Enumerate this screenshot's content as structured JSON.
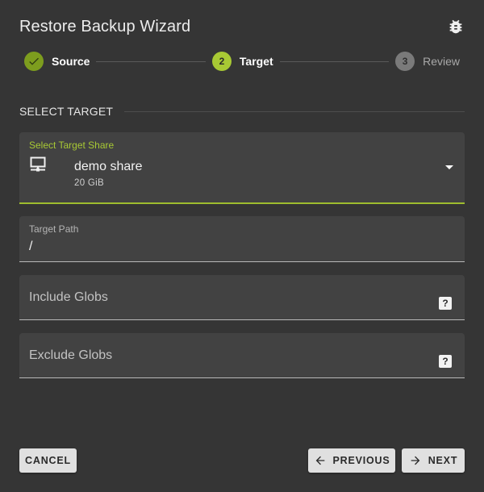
{
  "dialog": {
    "title": "Restore Backup Wizard",
    "icon": "bug-icon"
  },
  "stepper": {
    "steps": [
      {
        "number": "1",
        "label": "Source",
        "status": "completed"
      },
      {
        "number": "2",
        "label": "Target",
        "status": "active"
      },
      {
        "number": "3",
        "label": "Review",
        "status": "pending"
      }
    ]
  },
  "section": {
    "heading": "SELECT TARGET"
  },
  "target_share": {
    "label": "Select Target Share",
    "value": "demo share",
    "size": "20 GiB",
    "icon": "monitor-icon"
  },
  "target_path": {
    "label": "Target Path",
    "value": "/"
  },
  "include_globs": {
    "label": "Include Globs",
    "help": "?"
  },
  "exclude_globs": {
    "label": "Exclude Globs",
    "help": "?"
  },
  "buttons": {
    "cancel": "CANCEL",
    "previous": "PREVIOUS",
    "next": "NEXT"
  },
  "colors": {
    "accent": "#a8c934",
    "completed": "#7d9d1e",
    "background": "#353535",
    "field": "#424242"
  }
}
